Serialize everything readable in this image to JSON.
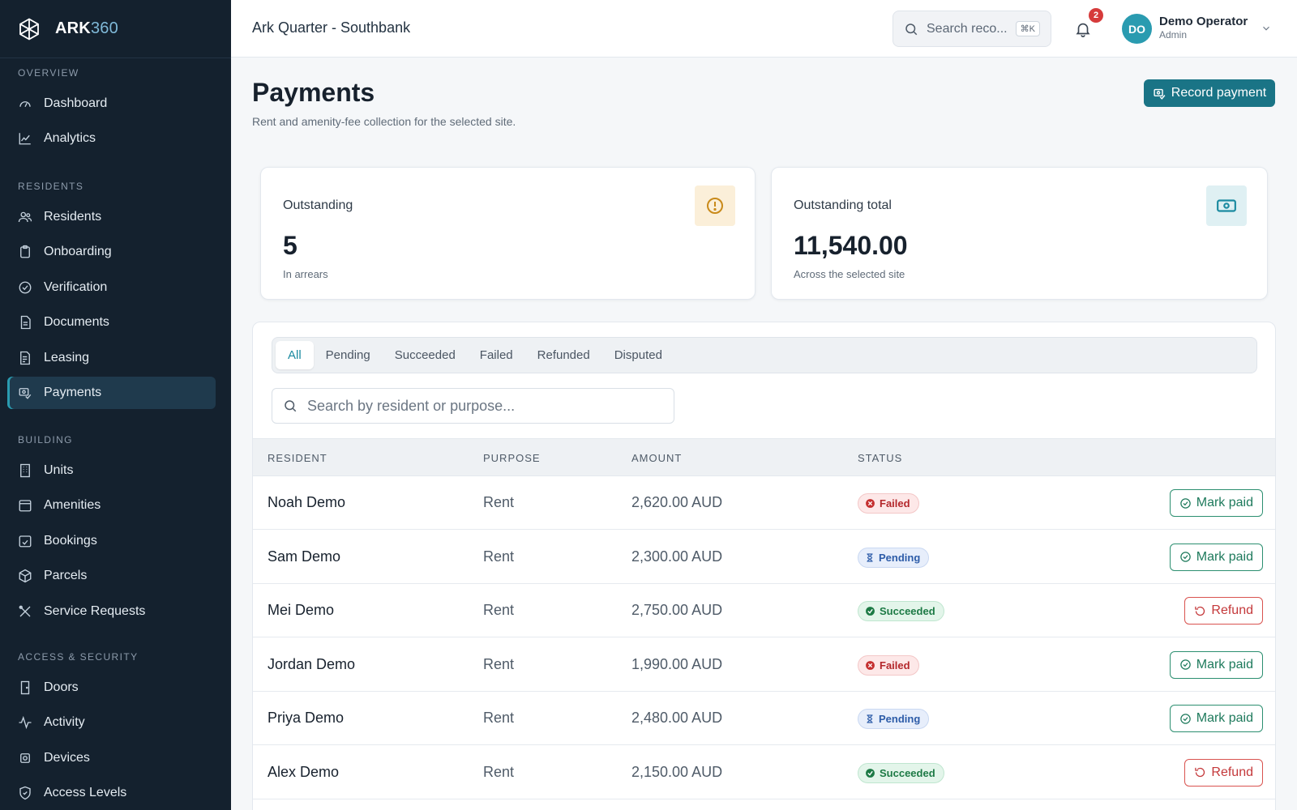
{
  "brand": {
    "name": "ARK",
    "name_accent": "360"
  },
  "sidebar": {
    "sections": [
      {
        "label": "OVERVIEW",
        "items": [
          {
            "label": "Dashboard",
            "icon": "gauge-icon"
          },
          {
            "label": "Analytics",
            "icon": "chart-line-icon"
          }
        ]
      },
      {
        "label": "RESIDENTS",
        "items": [
          {
            "label": "Residents",
            "icon": "users-icon"
          },
          {
            "label": "Onboarding",
            "icon": "clipboard-icon"
          },
          {
            "label": "Verification",
            "icon": "check-circle-icon"
          },
          {
            "label": "Documents",
            "icon": "document-icon"
          },
          {
            "label": "Leasing",
            "icon": "file-text-icon"
          },
          {
            "label": "Payments",
            "icon": "payment-icon",
            "active": true
          }
        ]
      },
      {
        "label": "BUILDING",
        "items": [
          {
            "label": "Units",
            "icon": "building-icon"
          },
          {
            "label": "Amenities",
            "icon": "calendar-icon"
          },
          {
            "label": "Bookings",
            "icon": "calendar-check-icon"
          },
          {
            "label": "Parcels",
            "icon": "package-icon"
          },
          {
            "label": "Service Requests",
            "icon": "tools-icon"
          }
        ]
      },
      {
        "label": "ACCESS & SECURITY",
        "items": [
          {
            "label": "Doors",
            "icon": "door-icon"
          },
          {
            "label": "Activity",
            "icon": "activity-icon"
          },
          {
            "label": "Devices",
            "icon": "device-icon"
          },
          {
            "label": "Access Levels",
            "icon": "shield-icon"
          }
        ]
      }
    ]
  },
  "topbar": {
    "site": "Ark Quarter - Southbank",
    "search_placeholder": "Search reco...",
    "search_shortcut": "⌘K",
    "notifications_count": "2",
    "user": {
      "initials": "DO",
      "name": "Demo Operator",
      "role": "Admin"
    }
  },
  "page": {
    "title": "Payments",
    "subtitle": "Rent and amenity-fee collection for the selected site.",
    "record_button": "Record payment"
  },
  "cards": [
    {
      "label": "Outstanding",
      "value": "5",
      "foot": "In arrears",
      "icon": "alert-circle-icon",
      "color": "#c98a1a"
    },
    {
      "label": "Outstanding total",
      "value": "11,540.00",
      "foot": "Across the selected site",
      "icon": "banknote-icon",
      "color": "#1a8aa0"
    }
  ],
  "tabs": [
    "All",
    "Pending",
    "Succeeded",
    "Failed",
    "Refunded",
    "Disputed"
  ],
  "active_tab": "All",
  "table_search_placeholder": "Search by resident or purpose...",
  "table": {
    "headers": [
      "RESIDENT",
      "PURPOSE",
      "AMOUNT",
      "STATUS"
    ],
    "rows": [
      {
        "resident": "Noah Demo",
        "purpose": "Rent",
        "amount": "2,620.00 AUD",
        "status": "Failed",
        "action": "Mark paid"
      },
      {
        "resident": "Sam Demo",
        "purpose": "Rent",
        "amount": "2,300.00 AUD",
        "status": "Pending",
        "action": "Mark paid"
      },
      {
        "resident": "Mei Demo",
        "purpose": "Rent",
        "amount": "2,750.00 AUD",
        "status": "Succeeded",
        "action": "Refund"
      },
      {
        "resident": "Jordan Demo",
        "purpose": "Rent",
        "amount": "1,990.00 AUD",
        "status": "Failed",
        "action": "Mark paid"
      },
      {
        "resident": "Priya Demo",
        "purpose": "Rent",
        "amount": "2,480.00 AUD",
        "status": "Pending",
        "action": "Mark paid"
      },
      {
        "resident": "Alex Demo",
        "purpose": "Rent",
        "amount": "2,150.00 AUD",
        "status": "Succeeded",
        "action": "Refund"
      }
    ]
  },
  "colors": {
    "sidebar_bg": "#14212e",
    "accent": "#1a7486",
    "failed": "#b4282c",
    "pending": "#2d5ca8",
    "succeeded": "#1d7a45"
  }
}
